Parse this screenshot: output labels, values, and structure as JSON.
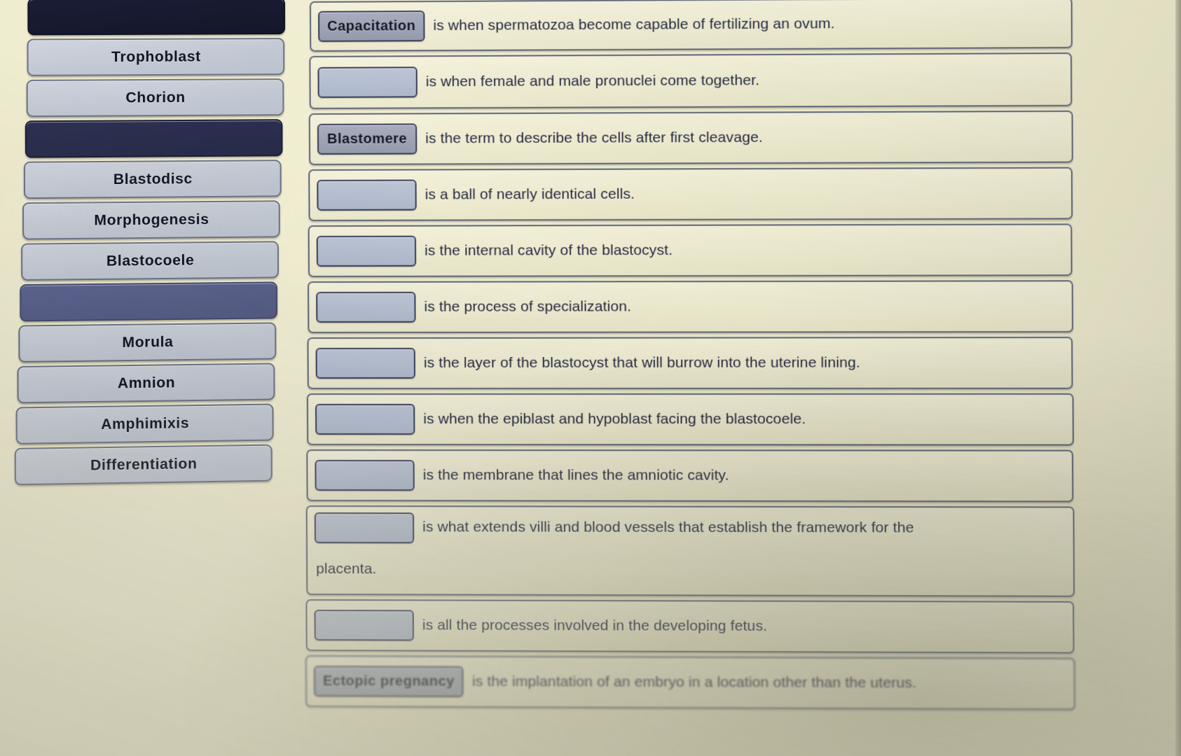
{
  "theme": {
    "page_background": "#ece9cf",
    "tile_light": "#c5cad4",
    "tile_dark": "#2d3152",
    "tile_darkest": "#1b1d37",
    "tile_mid": "#5d6592",
    "slot_empty": "#b0bcd0",
    "slot_filled": "#9aa0b0",
    "text_color": "#23283c",
    "border_color": "#3a405c"
  },
  "word_bank": {
    "name": "word-bank",
    "items": [
      {
        "label": "",
        "state": "used-darkest"
      },
      {
        "label": "Trophoblast",
        "state": "available"
      },
      {
        "label": "Chorion",
        "state": "available"
      },
      {
        "label": "",
        "state": "used-dark"
      },
      {
        "label": "Blastodisc",
        "state": "available"
      },
      {
        "label": "Morphogenesis",
        "state": "available"
      },
      {
        "label": "Blastocoele",
        "state": "available"
      },
      {
        "label": "",
        "state": "used-mid"
      },
      {
        "label": "Morula",
        "state": "available"
      },
      {
        "label": "Amnion",
        "state": "available"
      },
      {
        "label": "Amphimixis",
        "state": "available"
      },
      {
        "label": "Differentiation",
        "state": "available"
      }
    ]
  },
  "statements": {
    "name": "matching-statements",
    "rows": [
      {
        "answer": "Capacitation",
        "filled": true,
        "text": "is when spermatozoa become capable of fertilizing an ovum.",
        "wrap": ""
      },
      {
        "answer": "",
        "filled": false,
        "text": "is when female and male pronuclei come together.",
        "wrap": ""
      },
      {
        "answer": "Blastomere",
        "filled": true,
        "text": "is the term to describe the cells after first cleavage.",
        "wrap": ""
      },
      {
        "answer": "",
        "filled": false,
        "text": "is a ball of nearly identical cells.",
        "wrap": ""
      },
      {
        "answer": "",
        "filled": false,
        "text": "is the internal cavity of the blastocyst.",
        "wrap": ""
      },
      {
        "answer": "",
        "filled": false,
        "text": "is the process of specialization.",
        "wrap": ""
      },
      {
        "answer": "",
        "filled": false,
        "text": "is the layer of the blastocyst that will burrow into the uterine lining.",
        "wrap": ""
      },
      {
        "answer": "",
        "filled": false,
        "text": "is when the epiblast and hypoblast facing the blastocoele.",
        "wrap": ""
      },
      {
        "answer": "",
        "filled": false,
        "text": "is the membrane that lines the amniotic cavity.",
        "wrap": ""
      },
      {
        "answer": "",
        "filled": false,
        "text": "is what extends villi and blood vessels that establish the framework for the",
        "wrap": "placenta."
      },
      {
        "answer": "",
        "filled": false,
        "text": "is all the processes involved in the developing fetus.",
        "wrap": ""
      },
      {
        "answer": "Ectopic pregnancy",
        "filled": true,
        "text": "is the implantation of an embryo in a location other than the uterus.",
        "wrap": ""
      }
    ]
  }
}
